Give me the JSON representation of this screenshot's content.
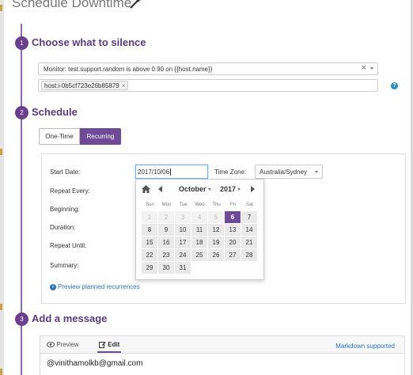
{
  "page": {
    "title": "Schedule Downtime"
  },
  "sections": [
    {
      "num": "1",
      "title": "Choose what to silence"
    },
    {
      "num": "2",
      "title": "Schedule"
    },
    {
      "num": "3",
      "title": "Add a message"
    }
  ],
  "silence": {
    "monitor_value": "Monitor: test.support.random is above 0.90 on {{host.name}}",
    "clear_glyph": "×",
    "tag": "host:i-0b5cf723e26b85879",
    "tag_remove_glyph": "×",
    "help_glyph": "?"
  },
  "schedule": {
    "toggle": {
      "one_time": "One-Time",
      "recurring": "Recurring",
      "active": "recurring"
    },
    "labels": {
      "start_date": "Start Date:",
      "repeat_every": "Repeat Every:",
      "beginning": "Beginning:",
      "duration": "Duration:",
      "repeat_until": "Repeat Until:",
      "summary": "Summary:"
    },
    "start_date_value": "2017/10/06",
    "timezone_label": "Time Zone:",
    "timezone_value": "Australia/Sydney",
    "preview_link": "Preview planned recurrences",
    "info_glyph": "i"
  },
  "calendar": {
    "month": "October",
    "year": "2017",
    "weekdays": [
      "Sun",
      "Mon",
      "Tue",
      "Wed",
      "Thu",
      "Fri",
      "Sat"
    ],
    "weeks": [
      [
        {
          "d": "1",
          "dim": true
        },
        {
          "d": "2",
          "dim": true
        },
        {
          "d": "3",
          "dim": true
        },
        {
          "d": "4",
          "dim": true
        },
        {
          "d": "5",
          "dim": true
        },
        {
          "d": "6",
          "sel": true
        },
        {
          "d": "7"
        }
      ],
      [
        {
          "d": "8"
        },
        {
          "d": "9"
        },
        {
          "d": "10"
        },
        {
          "d": "11"
        },
        {
          "d": "12"
        },
        {
          "d": "13"
        },
        {
          "d": "14"
        }
      ],
      [
        {
          "d": "15"
        },
        {
          "d": "16"
        },
        {
          "d": "17"
        },
        {
          "d": "18"
        },
        {
          "d": "19"
        },
        {
          "d": "20"
        },
        {
          "d": "21"
        }
      ],
      [
        {
          "d": "22"
        },
        {
          "d": "23"
        },
        {
          "d": "24"
        },
        {
          "d": "25"
        },
        {
          "d": "26"
        },
        {
          "d": "27"
        },
        {
          "d": "28"
        }
      ],
      [
        {
          "d": "29"
        },
        {
          "d": "30"
        },
        {
          "d": "31"
        }
      ]
    ]
  },
  "message": {
    "tab_preview": "Preview",
    "tab_edit": "Edit",
    "active_tab": "edit",
    "markdown_link": "Markdown supported",
    "text": "@vinithamolkb@gmail.com"
  },
  "colors": {
    "accent": "#6f4a96",
    "link": "#2b72b8",
    "section_title": "#5a3a7a"
  },
  "icons": [
    "magic-wand-icon",
    "home-icon",
    "prev-month-icon",
    "next-month-icon",
    "help-icon",
    "info-icon",
    "eye-icon",
    "edit-icon"
  ]
}
